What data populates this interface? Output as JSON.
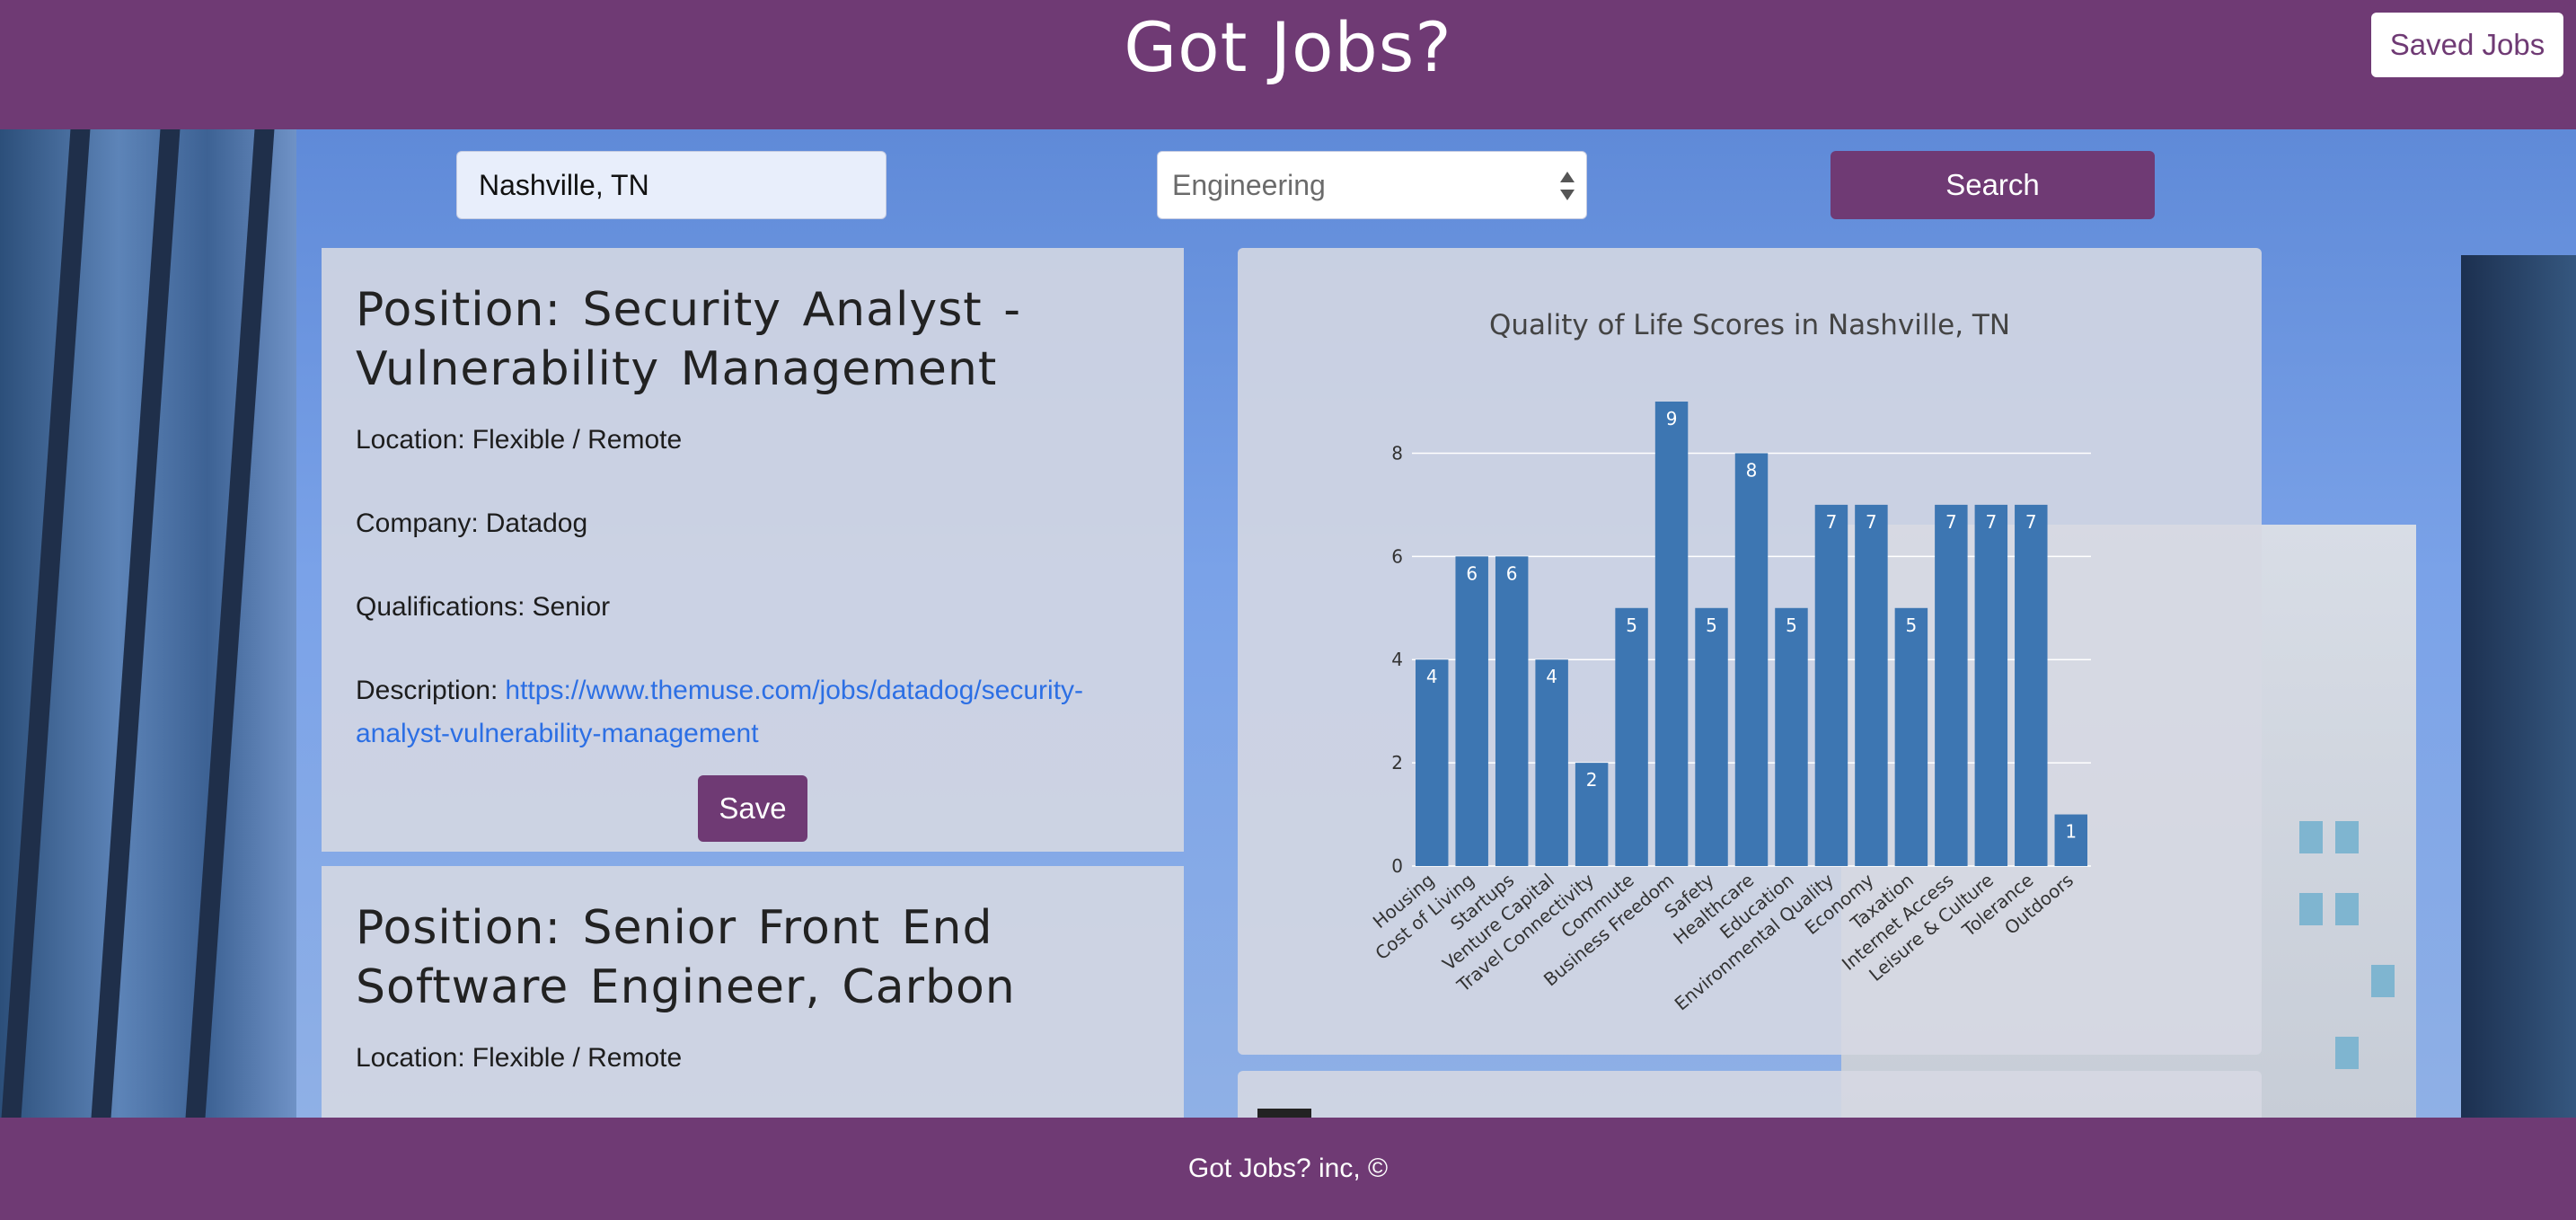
{
  "header": {
    "title": "Got Jobs?",
    "saved_jobs_label": "Saved Jobs"
  },
  "search": {
    "location_value": "Nashville, TN",
    "category_selected": "Engineering",
    "search_label": "Search"
  },
  "jobs": [
    {
      "title": "Position: Security Analyst - Vulnerability Management",
      "location_label": "Location:",
      "location": "Flexible / Remote",
      "company_label": "Company:",
      "company": "Datadog",
      "qualifications_label": "Qualifications:",
      "qualifications": "Senior",
      "description_label": "Description:",
      "description_url": "https://www.themuse.com/jobs/datadog/security-analyst-vulnerability-management",
      "save_label": "Save"
    },
    {
      "title": "Position: Senior Front End Software Engineer, Carbon",
      "location_label": "Location:",
      "location": "Flexible / Remote"
    }
  ],
  "chart_data": {
    "type": "bar",
    "title": "Quality of Life Scores in Nashville, TN",
    "categories": [
      "Housing",
      "Cost of Living",
      "Startups",
      "Venture Capital",
      "Travel Connectivity",
      "Commute",
      "Business Freedom",
      "Safety",
      "Healthcare",
      "Education",
      "Environmental Quality",
      "Economy",
      "Taxation",
      "Internet Access",
      "Leisure & Culture",
      "Tolerance",
      "Outdoors"
    ],
    "values": [
      4,
      6,
      6,
      4,
      2,
      5,
      9,
      5,
      8,
      5,
      7,
      7,
      5,
      7,
      7,
      7,
      1
    ],
    "yticks": [
      0,
      2,
      4,
      6,
      8
    ],
    "ylim": [
      0,
      9
    ],
    "grid": true,
    "bar_color": "#3d76b2"
  },
  "footer": {
    "text": "Got Jobs? inc, ©"
  },
  "colors": {
    "brand": "#6f3a74",
    "link": "#2c6fe4"
  }
}
